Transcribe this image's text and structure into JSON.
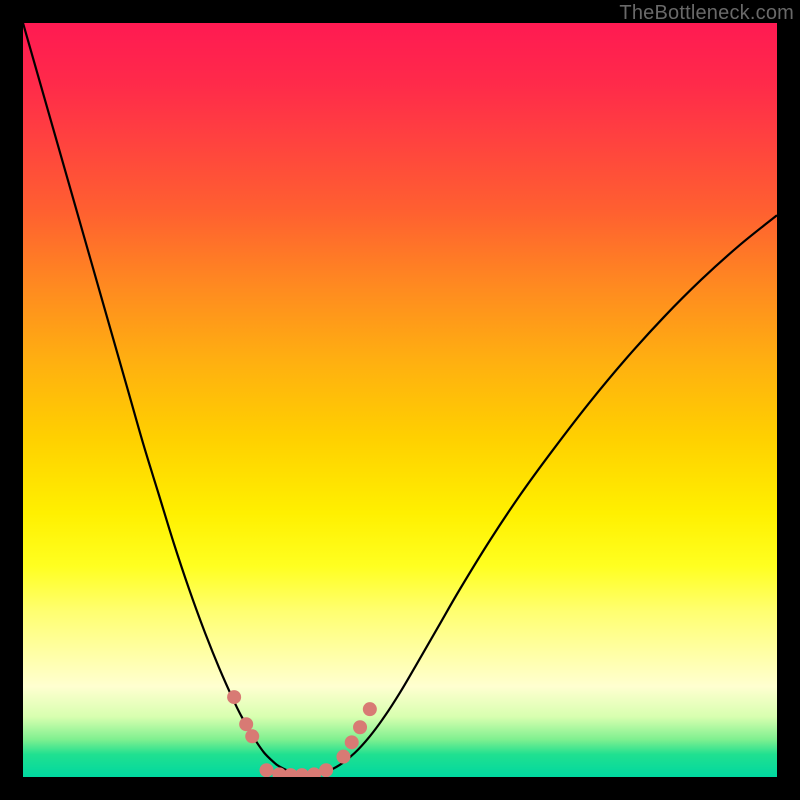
{
  "watermark": {
    "text": "TheBottleneck.com"
  },
  "palette": {
    "curve_stroke": "#000000",
    "marker_fill": "#d87a74",
    "marker_stroke": "#d87a74"
  },
  "chart_data": {
    "type": "line",
    "title": "",
    "xlabel": "",
    "ylabel": "",
    "xlim": [
      0,
      100
    ],
    "ylim": [
      0,
      100
    ],
    "grid": false,
    "series": [
      {
        "name": "left-curve",
        "x": [
          0,
          2,
          4,
          6,
          8,
          10,
          12,
          14,
          16,
          18,
          20,
          22,
          24,
          26,
          28,
          29,
          30,
          31,
          32,
          33,
          34,
          36,
          38
        ],
        "values": [
          100,
          93,
          86,
          79,
          72,
          65,
          58,
          51,
          44,
          37.5,
          31,
          25,
          19.5,
          14.5,
          10,
          8,
          6.2,
          4.6,
          3.2,
          2.2,
          1.4,
          0.5,
          0.1
        ]
      },
      {
        "name": "right-curve",
        "x": [
          38,
          40,
          42,
          44,
          46,
          48,
          50,
          52,
          55,
          58,
          62,
          66,
          70,
          75,
          80,
          85,
          90,
          95,
          100
        ],
        "values": [
          0.1,
          0.6,
          1.6,
          3.2,
          5.4,
          8.1,
          11.2,
          14.6,
          19.8,
          25,
          31.5,
          37.5,
          43,
          49.5,
          55.5,
          61,
          66,
          70.5,
          74.5
        ]
      }
    ],
    "markers": [
      {
        "x": 28.0,
        "y": 10.6
      },
      {
        "x": 29.6,
        "y": 7.0
      },
      {
        "x": 30.4,
        "y": 5.4
      },
      {
        "x": 32.3,
        "y": 0.9
      },
      {
        "x": 34.0,
        "y": 0.35
      },
      {
        "x": 35.5,
        "y": 0.25
      },
      {
        "x": 37.0,
        "y": 0.25
      },
      {
        "x": 38.6,
        "y": 0.35
      },
      {
        "x": 40.2,
        "y": 0.9
      },
      {
        "x": 42.5,
        "y": 2.7
      },
      {
        "x": 43.6,
        "y": 4.6
      },
      {
        "x": 44.7,
        "y": 6.6
      },
      {
        "x": 46.0,
        "y": 9.0
      }
    ]
  }
}
